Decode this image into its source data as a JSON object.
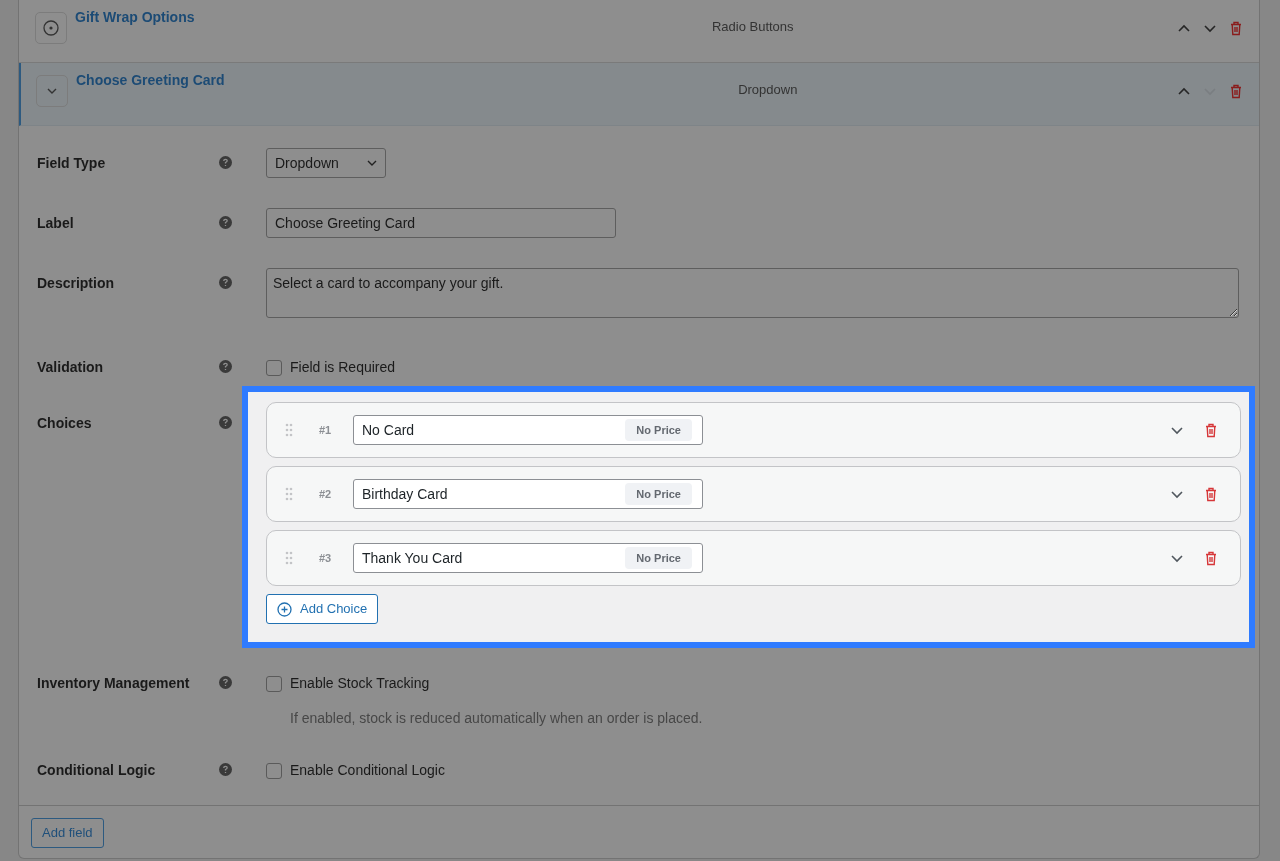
{
  "fields": [
    {
      "title": "Gift Wrap Options",
      "type_label": "Radio Buttons",
      "expanded": false,
      "move_up_disabled": false,
      "move_down_disabled": false
    },
    {
      "title": "Choose Greeting Card",
      "type_label": "Dropdown",
      "expanded": true,
      "move_up_disabled": false,
      "move_down_disabled": true
    }
  ],
  "settings": [
    {
      "kind": "select",
      "label": "Field Type",
      "value": "Dropdown"
    },
    {
      "kind": "text",
      "label": "Label",
      "value": "Choose Greeting Card"
    },
    {
      "kind": "textarea",
      "label": "Description",
      "value": "Select a card to accompany your gift."
    },
    {
      "kind": "checkbox",
      "label": "Validation",
      "option": "Field is Required",
      "checked": false
    },
    {
      "kind": "choices",
      "label": "Choices",
      "highlighted": true,
      "choices": [
        {
          "number": "#1",
          "value": "No Card",
          "price": "No Price"
        },
        {
          "number": "#2",
          "value": "Birthday Card",
          "price": "No Price"
        },
        {
          "number": "#3",
          "value": "Thank You Card",
          "price": "No Price"
        }
      ],
      "add_button": "Add Choice"
    },
    {
      "kind": "checkbox",
      "label": "Inventory Management",
      "option": "Enable Stock Tracking",
      "checked": false,
      "note": "If enabled, stock is reduced automatically when an order is placed."
    },
    {
      "kind": "checkbox",
      "label": "Conditional Logic",
      "option": "Enable Conditional Logic",
      "checked": false
    }
  ],
  "add_field_button": "Add field"
}
